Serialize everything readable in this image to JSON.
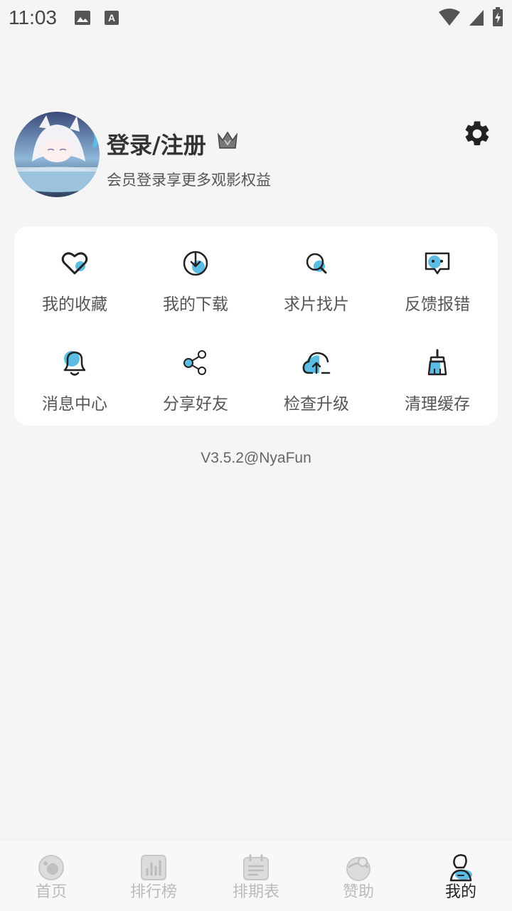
{
  "status_bar": {
    "time": "11:03",
    "icons": [
      "image-icon",
      "text-a-icon",
      "wifi-icon",
      "signal-icon",
      "battery-charging-icon"
    ]
  },
  "profile": {
    "title": "登录/注册",
    "subtitle": "会员登录享更多观影权益",
    "crown_icon": "crown-icon",
    "settings_icon": "gear-icon"
  },
  "grid": {
    "items": [
      {
        "label": "我的收藏",
        "icon": "heart-icon"
      },
      {
        "label": "我的下载",
        "icon": "download-icon"
      },
      {
        "label": "求片找片",
        "icon": "search-icon"
      },
      {
        "label": "反馈报错",
        "icon": "feedback-icon"
      },
      {
        "label": "消息中心",
        "icon": "bell-icon"
      },
      {
        "label": "分享好友",
        "icon": "share-icon"
      },
      {
        "label": "检查升级",
        "icon": "cloud-upload-icon"
      },
      {
        "label": "清理缓存",
        "icon": "broom-icon"
      }
    ]
  },
  "version": "V3.5.2@NyaFun",
  "bottom_nav": {
    "items": [
      {
        "label": "首页",
        "icon": "home-icon",
        "active": false
      },
      {
        "label": "排行榜",
        "icon": "ranking-icon",
        "active": false
      },
      {
        "label": "排期表",
        "icon": "schedule-icon",
        "active": false
      },
      {
        "label": "赞助",
        "icon": "sponsor-icon",
        "active": false
      },
      {
        "label": "我的",
        "icon": "profile-icon",
        "active": true
      }
    ]
  },
  "colors": {
    "accent": "#5bbce4",
    "background": "#f5f5f5",
    "card": "#ffffff",
    "text": "#333333"
  }
}
